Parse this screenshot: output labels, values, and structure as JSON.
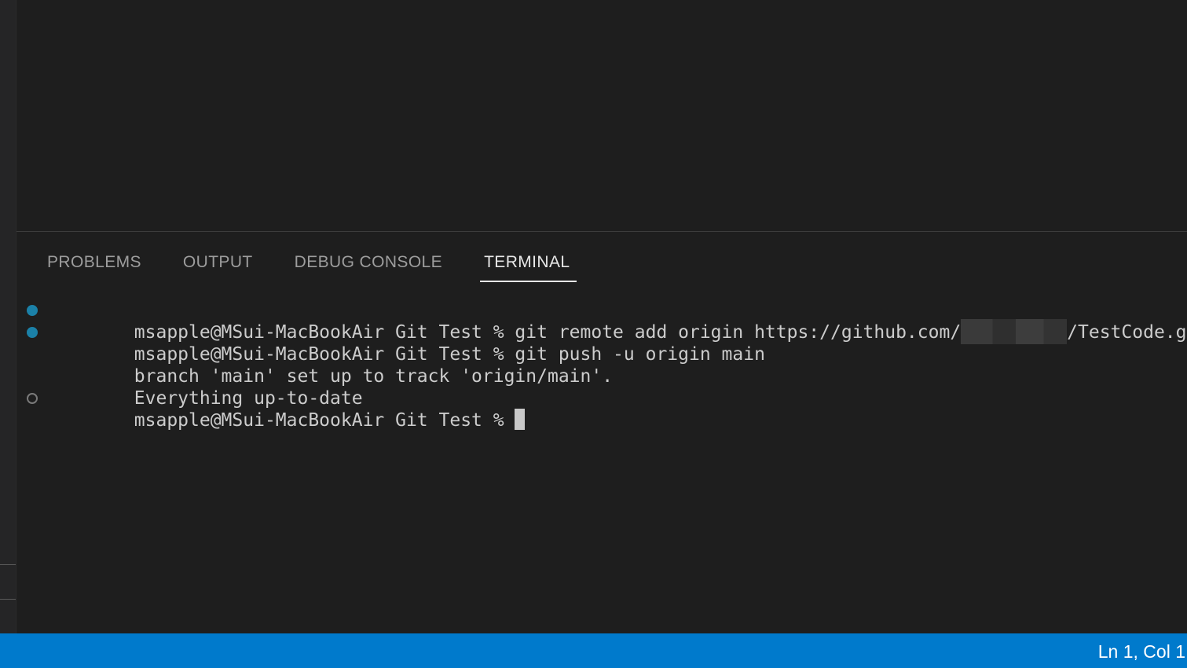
{
  "panel": {
    "tabs": [
      {
        "label": "PROBLEMS"
      },
      {
        "label": "OUTPUT"
      },
      {
        "label": "DEBUG CONSOLE"
      },
      {
        "label": "TERMINAL"
      }
    ],
    "active_tab": "TERMINAL"
  },
  "terminal": {
    "lines": [
      {
        "text": "msapple@MSui-MacBookAir Git Test % git remote add origin https://github.com/",
        "suffix": "/TestCode.git",
        "decoration": "blue-dot-icon"
      },
      {
        "text": "msapple@MSui-MacBookAir Git Test % git push -u origin main",
        "decoration": "blue-dot-icon"
      },
      {
        "text": "branch 'main' set up to track 'origin/main'."
      },
      {
        "text": "Everything up-to-date"
      },
      {
        "text": "msapple@MSui-MacBookAir Git Test % ",
        "decoration": "hollow-circle-icon"
      }
    ]
  },
  "statusbar": {
    "cursor_position": "Ln 1, Col 1"
  },
  "colors": {
    "background": "#1e1e1e",
    "statusbar": "#007acc",
    "decoration_success": "#1b81a8"
  }
}
